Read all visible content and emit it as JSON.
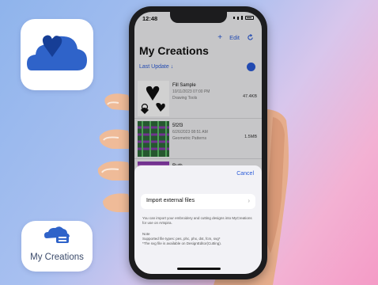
{
  "tiles": {
    "bottom_label": "My Creations"
  },
  "phone": {
    "time": "12:48",
    "toolbar": {
      "add": "+",
      "edit": "Edit"
    },
    "title": "My Creations",
    "sort_label": "Last Update ↓",
    "items": [
      {
        "name": "Fill Sample",
        "date": "10/11/2023 07:00 PM",
        "desc": "Drawing Tools",
        "size": "47.4KB"
      },
      {
        "name": "5f2f3",
        "date": "6/26/2023 08:51 AM",
        "desc": "Geometric Patterns",
        "size": "1.5MB"
      },
      {
        "name": "Ruth",
        "date": "",
        "desc": "",
        "size": ""
      }
    ],
    "sheet": {
      "cancel": "Cancel",
      "import_label": "Import external files",
      "info": "You can import your embroidery and cutting designs into MyCreations for use on Artspira.",
      "note_heading": "Note",
      "note_line1": "Supported file types:  pes, phc, phx, dst, fcm, svg*",
      "note_line2": "*The svg file is available on DesignEditor(Cutting)."
    }
  },
  "colors": {
    "accent": "#2a5bd8",
    "cloud": "#2f63c9",
    "heart": "#163e96"
  }
}
